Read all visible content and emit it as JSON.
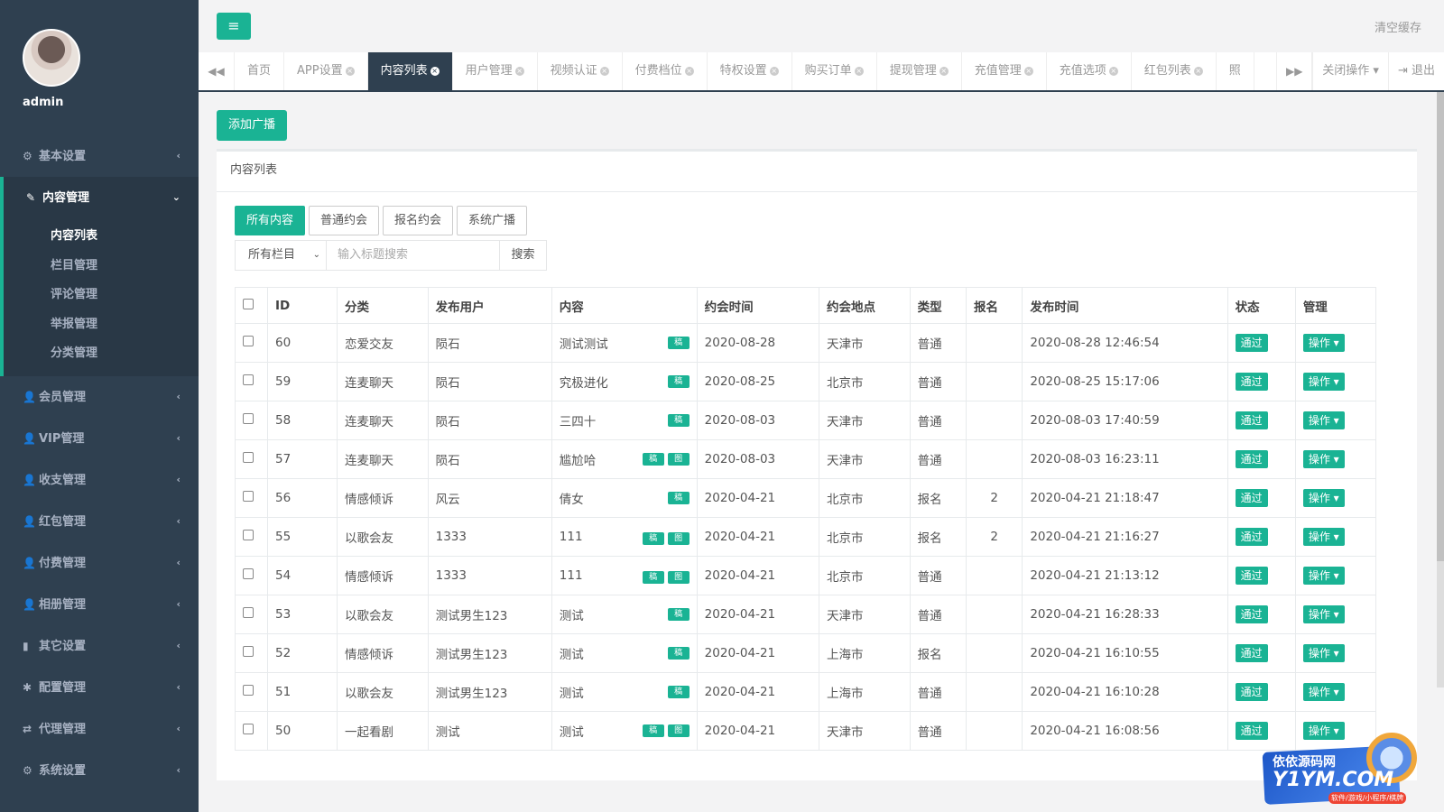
{
  "sidebar": {
    "admin_name": "admin",
    "items": [
      {
        "label": "基本设置",
        "icon": "gear-icon"
      },
      {
        "label": "内容管理",
        "icon": "edit-icon",
        "active": true
      },
      {
        "label": "会员管理",
        "icon": "user-icon"
      },
      {
        "label": "VIP管理",
        "icon": "user-icon"
      },
      {
        "label": "收支管理",
        "icon": "user-icon"
      },
      {
        "label": "红包管理",
        "icon": "user-icon"
      },
      {
        "label": "付费管理",
        "icon": "user-icon"
      },
      {
        "label": "相册管理",
        "icon": "user-icon"
      },
      {
        "label": "其它设置",
        "icon": "book-icon"
      },
      {
        "label": "配置管理",
        "icon": "asterisk-icon"
      },
      {
        "label": "代理管理",
        "icon": "exchange-icon"
      },
      {
        "label": "系统设置",
        "icon": "cogs-icon"
      }
    ],
    "submenu": [
      "内容列表",
      "栏目管理",
      "评论管理",
      "举报管理",
      "分类管理"
    ]
  },
  "topbar": {
    "menu_icon": "hamburger-icon",
    "clear_cache": "清空缓存"
  },
  "tabs": {
    "items": [
      "首页",
      "APP设置",
      "内容列表",
      "用户管理",
      "视频认证",
      "付费档位",
      "特权设置",
      "购买订单",
      "提现管理",
      "充值管理",
      "充值选项",
      "红包列表",
      "照"
    ],
    "active_index": 2,
    "close_ops": "关闭操作",
    "logout": "退出"
  },
  "main": {
    "add_button": "添加广播",
    "panel_title": "内容列表",
    "filter_tabs": [
      "所有内容",
      "普通约会",
      "报名约会",
      "系统广播"
    ],
    "select_value": "所有栏目",
    "search_placeholder": "输入标题搜索",
    "search_button": "搜索",
    "columns": [
      "ID",
      "分类",
      "发布用户",
      "内容",
      "约会时间",
      "约会地点",
      "类型",
      "报名",
      "发布时间",
      "状态",
      "管理"
    ],
    "mini_tags": {
      "text": "稿",
      "image": "图"
    },
    "status_label": "通过",
    "op_label": "操作",
    "rows": [
      {
        "id": "60",
        "cat": "恋爱交友",
        "user": "陨石",
        "content": "测试测试",
        "tags": 1,
        "date": "2020-08-28",
        "place": "天津市",
        "type": "普通",
        "signup": "",
        "published": "2020-08-28 12:46:54"
      },
      {
        "id": "59",
        "cat": "连麦聊天",
        "user": "陨石",
        "content": "究极进化",
        "tags": 1,
        "date": "2020-08-25",
        "place": "北京市",
        "type": "普通",
        "signup": "",
        "published": "2020-08-25 15:17:06"
      },
      {
        "id": "58",
        "cat": "连麦聊天",
        "user": "陨石",
        "content": "三四十",
        "tags": 1,
        "date": "2020-08-03",
        "place": "天津市",
        "type": "普通",
        "signup": "",
        "published": "2020-08-03 17:40:59"
      },
      {
        "id": "57",
        "cat": "连麦聊天",
        "user": "陨石",
        "content": "尴尬哈",
        "tags": 2,
        "date": "2020-08-03",
        "place": "天津市",
        "type": "普通",
        "signup": "",
        "published": "2020-08-03 16:23:11"
      },
      {
        "id": "56",
        "cat": "情感倾诉",
        "user": "风云",
        "content": "倩女",
        "tags": 1,
        "date": "2020-04-21",
        "place": "北京市",
        "type": "报名",
        "signup": "2",
        "published": "2020-04-21 21:18:47"
      },
      {
        "id": "55",
        "cat": "以歌会友",
        "user": "1333",
        "content": "111",
        "tags": 2,
        "date": "2020-04-21",
        "place": "北京市",
        "type": "报名",
        "signup": "2",
        "published": "2020-04-21 21:16:27"
      },
      {
        "id": "54",
        "cat": "情感倾诉",
        "user": "1333",
        "content": "111",
        "tags": 2,
        "date": "2020-04-21",
        "place": "北京市",
        "type": "普通",
        "signup": "",
        "published": "2020-04-21 21:13:12"
      },
      {
        "id": "53",
        "cat": "以歌会友",
        "user": "测试男生123",
        "content": "测试",
        "tags": 1,
        "date": "2020-04-21",
        "place": "天津市",
        "type": "普通",
        "signup": "",
        "published": "2020-04-21 16:28:33"
      },
      {
        "id": "52",
        "cat": "情感倾诉",
        "user": "测试男生123",
        "content": "测试",
        "tags": 1,
        "date": "2020-04-21",
        "place": "上海市",
        "type": "报名",
        "signup": "",
        "published": "2020-04-21 16:10:55"
      },
      {
        "id": "51",
        "cat": "以歌会友",
        "user": "测试男生123",
        "content": "测试",
        "tags": 1,
        "date": "2020-04-21",
        "place": "上海市",
        "type": "普通",
        "signup": "",
        "published": "2020-04-21 16:10:28"
      },
      {
        "id": "50",
        "cat": "一起看剧",
        "user": "测试",
        "content": "测试",
        "tags": 2,
        "date": "2020-04-21",
        "place": "天津市",
        "type": "普通",
        "signup": "",
        "published": "2020-04-21 16:08:56"
      }
    ]
  },
  "watermark": {
    "line1": "依依源码网",
    "line2": "Y1YM.COM",
    "line3": "软件/游戏/小程序/棋牌"
  },
  "colors": {
    "accent": "#1ab394",
    "sidebar": "#2f4050",
    "sidebar_active": "#293846"
  }
}
